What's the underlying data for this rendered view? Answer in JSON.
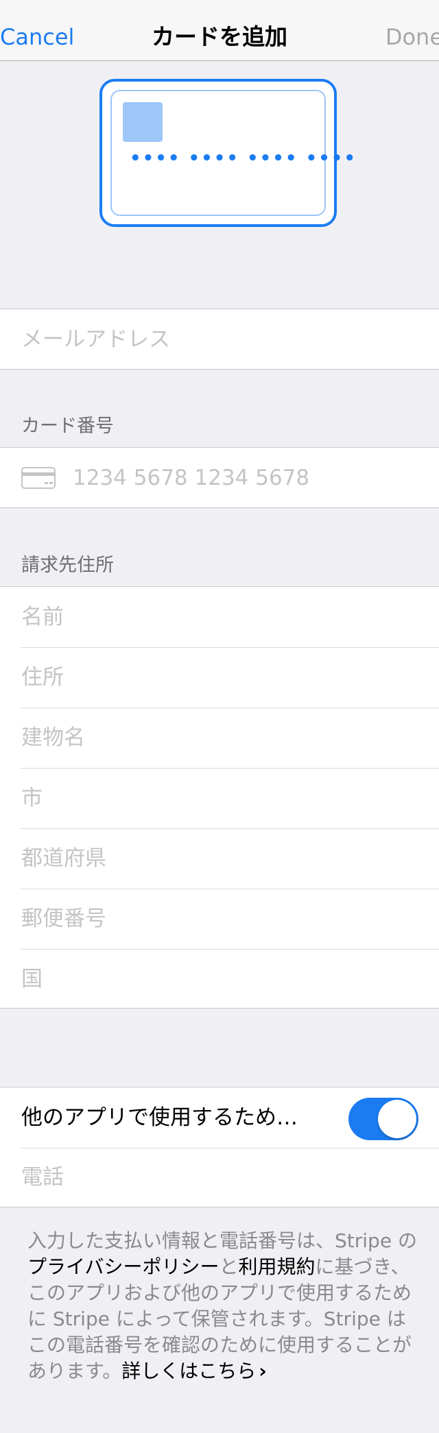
{
  "nav": {
    "cancel": "Cancel",
    "title": "カードを追加",
    "done": "Done"
  },
  "card_preview": {
    "number_mask": "•••• •••• •••• ••••",
    "accent_color": "#1b7cf2"
  },
  "email": {
    "placeholder": "メールアドレス"
  },
  "card_section": {
    "header": "カード番号",
    "icon": "credit-card-icon",
    "placeholder": "1234 5678 1234 5678"
  },
  "billing": {
    "header": "請求先住所",
    "fields": [
      "名前",
      "住所",
      "建物名",
      "市",
      "都道府県",
      "郵便番号",
      "国"
    ]
  },
  "save": {
    "label": "他のアプリで使用するため…",
    "toggle_on": true,
    "phone_placeholder": "電話"
  },
  "legal": {
    "text_1": "入力した支払い情報と電話番号は、Stripe の",
    "privacy_link": "プライバシーポリシー",
    "text_2": "と",
    "terms_link": "利用規約",
    "text_3": "に基づき、このアプリおよび他のアプリで使用するために Stripe によって保管されます。Stripe はこの電話番号を確認のために使用することがあります。",
    "more_link": "詳しくはこちら",
    "chevron": "›"
  }
}
